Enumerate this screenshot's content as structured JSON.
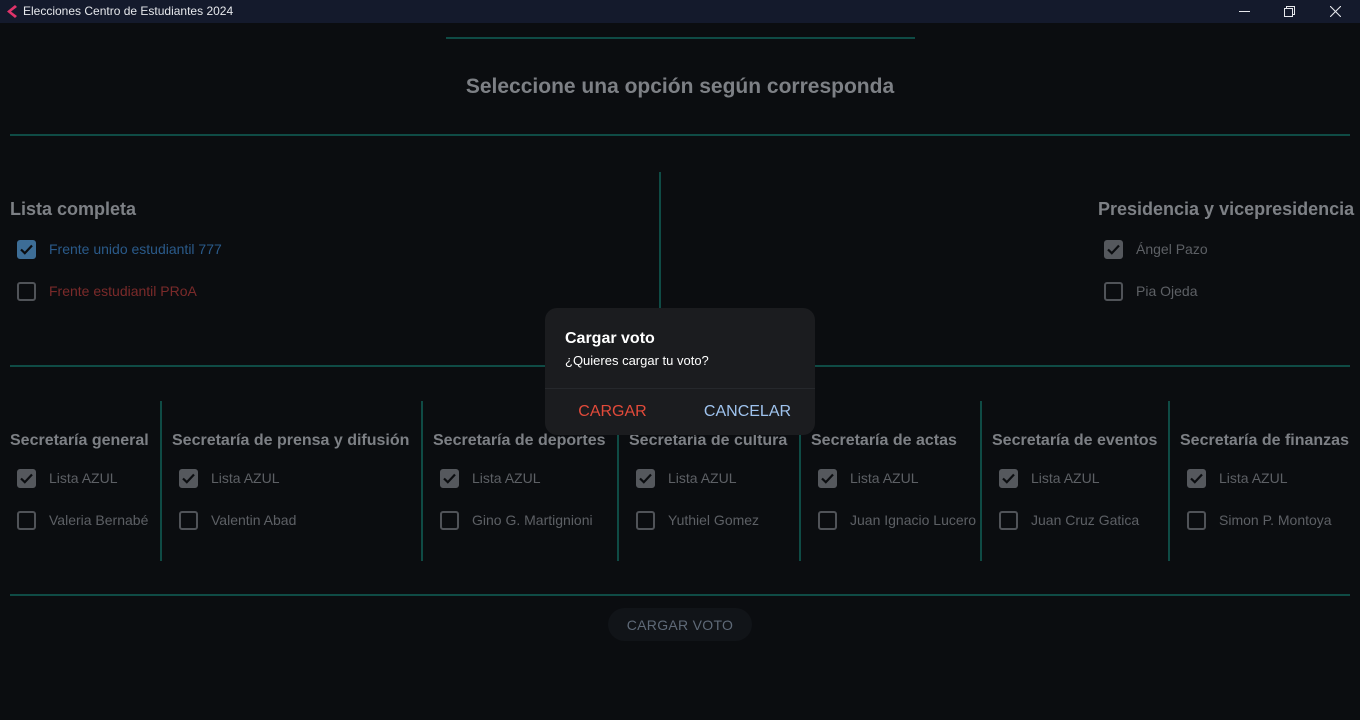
{
  "window": {
    "title": "Elecciones Centro de Estudiantes 2024",
    "controls": [
      "minimize-icon",
      "maximize-icon",
      "close-icon"
    ],
    "logo_color": "#e0336a"
  },
  "main": {
    "title": "Seleccione una opción según corresponda"
  },
  "lista_completa": {
    "title": "Lista completa",
    "options": [
      {
        "label": "Frente unido estudiantil 777",
        "checked": true,
        "color": "#2a5a8a"
      },
      {
        "label": "Frente estudiantil PRoA",
        "checked": false,
        "color": "#7a2a2a"
      }
    ]
  },
  "presidencia": {
    "title": "Presidencia y vicepresidencia",
    "options": [
      {
        "label": "Ángel Pazo",
        "checked": true
      },
      {
        "label": "Pia Ojeda",
        "checked": false
      }
    ]
  },
  "secretarias": [
    {
      "title": "Secretaría general",
      "options": [
        {
          "label": "Lista AZUL",
          "checked": true
        },
        {
          "label": "Valeria Bernabé",
          "checked": false
        }
      ]
    },
    {
      "title": "Secretaría de prensa y difusión",
      "options": [
        {
          "label": "Lista AZUL",
          "checked": true
        },
        {
          "label": "Valentin Abad",
          "checked": false
        }
      ]
    },
    {
      "title": "Secretaría de deportes",
      "options": [
        {
          "label": "Lista AZUL",
          "checked": true
        },
        {
          "label": "Gino G. Martignioni",
          "checked": false
        }
      ]
    },
    {
      "title": "Secretaría de cultura",
      "options": [
        {
          "label": "Lista AZUL",
          "checked": true
        },
        {
          "label": "Yuthiel Gomez",
          "checked": false
        }
      ]
    },
    {
      "title": "Secretaría de actas",
      "options": [
        {
          "label": "Lista AZUL",
          "checked": true
        },
        {
          "label": "Juan Ignacio Lucero",
          "checked": false
        }
      ]
    },
    {
      "title": "Secretaría de eventos",
      "options": [
        {
          "label": "Lista AZUL",
          "checked": true
        },
        {
          "label": "Juan Cruz Gatica",
          "checked": false
        }
      ]
    },
    {
      "title": "Secretaría de finanzas",
      "options": [
        {
          "label": "Lista AZUL",
          "checked": true
        },
        {
          "label": "Simon P. Montoya",
          "checked": false
        }
      ]
    }
  ],
  "footer": {
    "load_vote_label": "CARGAR VOTO"
  },
  "dialog": {
    "title": "Cargar voto",
    "message": "¿Quieres cargar tu voto?",
    "confirm_label": "CARGAR",
    "cancel_label": "CANCELAR",
    "confirm_color": "#e24a3a",
    "cancel_color": "#9fc3ee"
  }
}
